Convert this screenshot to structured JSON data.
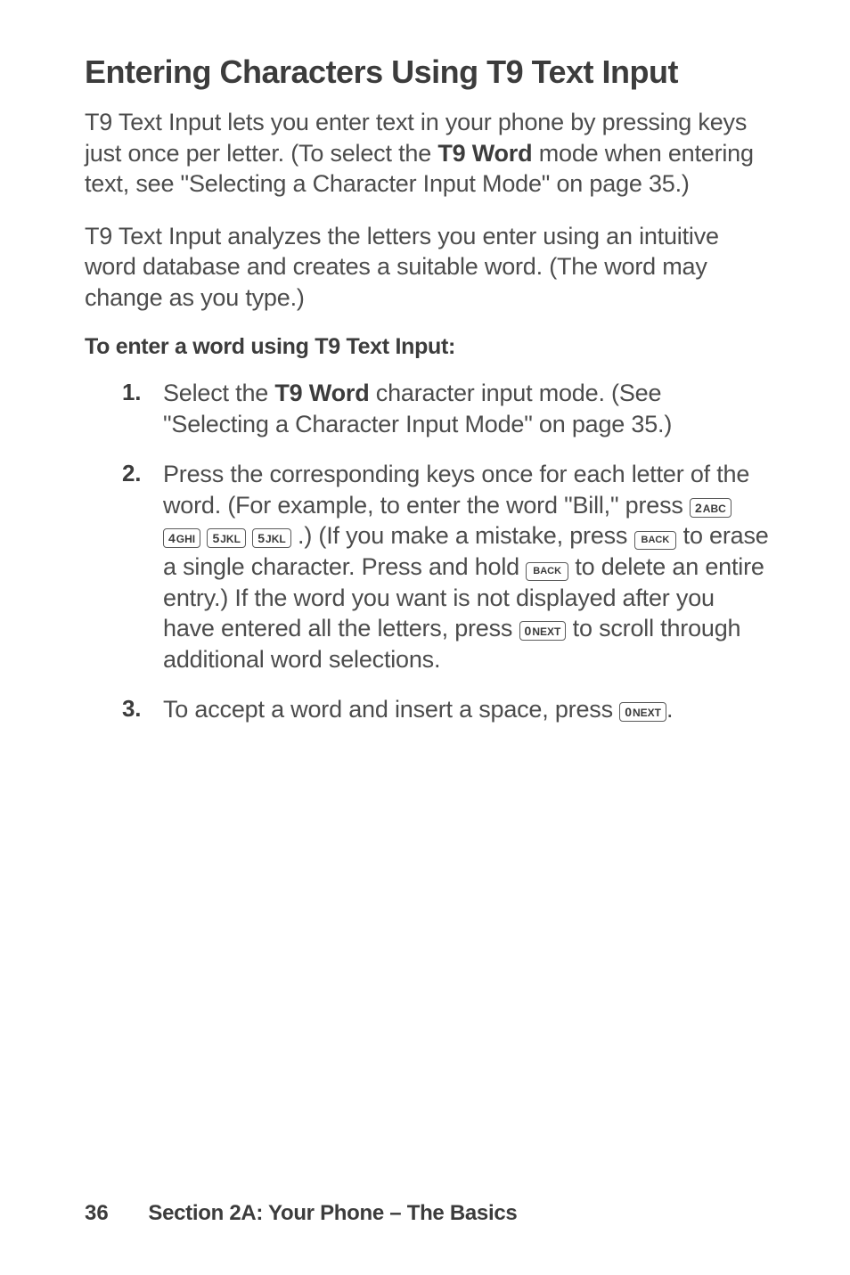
{
  "heading": "Entering Characters Using T9 Text Input",
  "para1_a": "T9 Text Input lets you enter text in your phone by pressing keys just once per letter. (To select the ",
  "para1_bold": "T9 Word",
  "para1_b": " mode when entering text, see \"Selecting a Character Input Mode\" on page 35.)",
  "para2": "T9 Text Input analyzes the letters you enter using an intuitive word database and creates a suitable word. (The word may change as you type.)",
  "subhead": "To enter a word using T9 Text Input:",
  "steps": {
    "s1_a": "Select the ",
    "s1_bold": "T9 Word",
    "s1_b": " character input mode. (See \"Selecting a Character Input Mode\" on page 35.)",
    "s2_a": "Press the corresponding keys once for each letter of the word. (For example, to enter the word \"Bill,\" press ",
    "s2_b": " .) (If you make a mistake, press ",
    "s2_c": " to erase a single character. Press and hold ",
    "s2_d": " to delete an entire entry.) If the word you want is not displayed after you have entered all the letters, press ",
    "s2_e": " to scroll through additional word selections.",
    "s3_a": "To accept a word and insert a space, press ",
    "s3_b": "."
  },
  "keys": {
    "k2": {
      "num": "2",
      "sub": "ABC"
    },
    "k4": {
      "num": "4",
      "sub": "GHI"
    },
    "k5a": {
      "num": "5",
      "sub": "JKL"
    },
    "k5b": {
      "num": "5",
      "sub": "JKL"
    },
    "back1": "BACK",
    "back2": "BACK",
    "zero1": {
      "num": "0",
      "sub": "NEXT"
    },
    "zero2": {
      "num": "0",
      "sub": "NEXT"
    }
  },
  "footer": {
    "page": "36",
    "section": "Section 2A: Your Phone – The Basics"
  }
}
